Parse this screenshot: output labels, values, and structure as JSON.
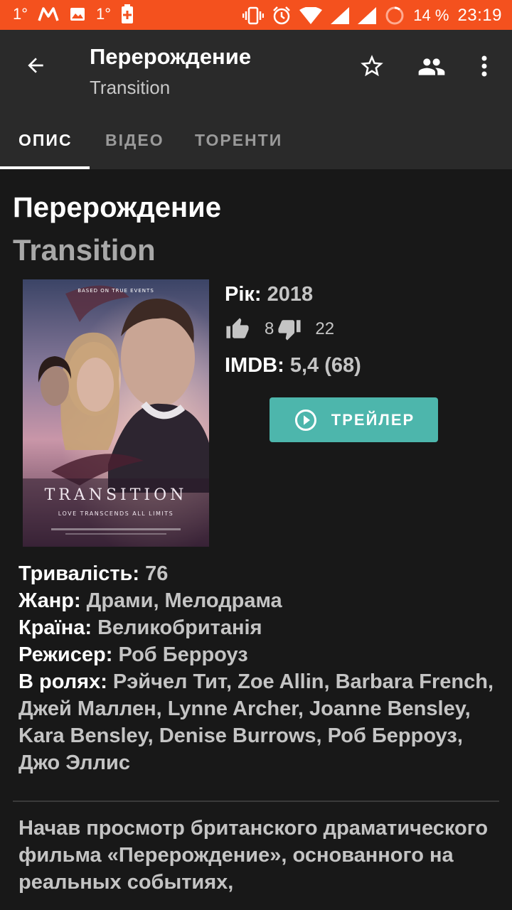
{
  "status_bar": {
    "left_items": [
      "1°",
      "1°"
    ],
    "battery_percent": "14 %",
    "time": "23:19",
    "accent": "#f4511e"
  },
  "app_bar": {
    "title": "Перерождение",
    "subtitle": "Transition",
    "icons": [
      "arrow-back-icon",
      "star-outline-icon",
      "people-icon",
      "more-vert-icon"
    ]
  },
  "tabs": [
    {
      "label": "ОПИС",
      "active": true
    },
    {
      "label": "ВІДЕО",
      "active": false
    },
    {
      "label": "ТОРЕНТИ",
      "active": false
    }
  ],
  "movie": {
    "title": "Перерождение",
    "original_title": "Transition",
    "year_label": "Рік",
    "year": "2018",
    "likes": "8",
    "dislikes": "22",
    "imdb_label": "IMDB",
    "imdb": "5,4 (68)",
    "trailer_label": "ТРЕЙЛЕР",
    "poster": {
      "top_text": "BASED ON TRUE EVENTS",
      "title": "TRANSITION",
      "tagline": "LOVE TRANSCENDS ALL LIMITS"
    }
  },
  "details": {
    "duration_label": "Тривалість",
    "duration": "76",
    "genre_label": "Жанр",
    "genre": "Драми, Мелодрама",
    "country_label": "Країна",
    "country": "Великобританія",
    "director_label": "Режисер",
    "director": "Роб Берроуз",
    "cast_label": "В ролях",
    "cast": "Рэйчел Тит, Zoe Allin, Barbara French, Джей Маллен, Lynne Archer, Joanne Bensley, Kara Bensley, Denise Burrows, Роб Берроуз, Джо Эллис"
  },
  "description": "Начав просмотр британского драматического фильма «Перерождение», основанного на реальных событиях,",
  "colors": {
    "background": "#181818",
    "app_bar": "#2a2a2a",
    "trailer_button": "#4db6ac",
    "secondary_text": "#c4c4c4"
  }
}
